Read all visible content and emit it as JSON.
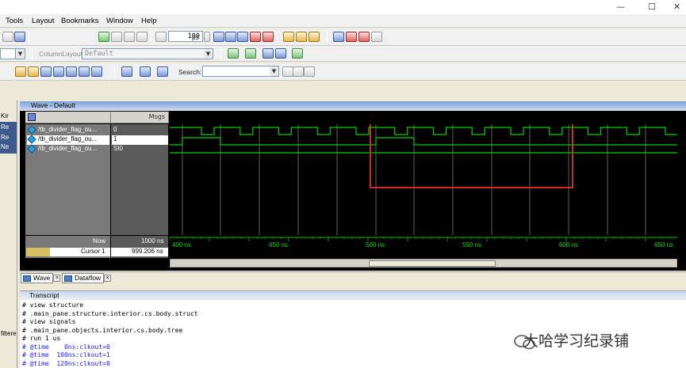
{
  "menu": [
    "Tools",
    "Layout",
    "Bookmarks",
    "Window",
    "Help"
  ],
  "toolbar": {
    "run_length_value": "100",
    "run_length_unit": "ps",
    "column_layout_label": "ColumnLayout",
    "column_layout_value": "Default",
    "search_label": "Search:"
  },
  "left_strip": [
    "Kir",
    "Re",
    "Re",
    "Ne",
    "filtere"
  ],
  "wave": {
    "title": "Wave - Default",
    "msgs_header": "Msgs",
    "signals": [
      {
        "name": "/tb_divider_flag_ou...",
        "value": "0"
      },
      {
        "name": "/tb_divider_flag_ou...",
        "value": "1"
      },
      {
        "name": "/tb_divider_flag_ou...",
        "value": "St0"
      }
    ],
    "now_label": "Now",
    "now_value": "1000 ns",
    "cursor_label": "Cursor 1",
    "cursor_value": "999.206 ns",
    "timescale": [
      "400 ns",
      "450 ns",
      "500 ns",
      "550 ns",
      "600 ns",
      "650 ns"
    ],
    "waveform_color": "#00d000",
    "highlight_color": "#e03030"
  },
  "tabs": [
    {
      "label": "Wave"
    },
    {
      "label": "Dataflow"
    }
  ],
  "transcript": {
    "title": "Transcript",
    "lines": [
      {
        "text": "# view structure",
        "color": "black"
      },
      {
        "text": "# .main_pane.structure.interior.cs.body.struct",
        "color": "black"
      },
      {
        "text": "# view signals",
        "color": "black"
      },
      {
        "text": "# .main_pane.objects.interior.cs.body.tree",
        "color": "black"
      },
      {
        "text": "# run 1 us",
        "color": "black"
      },
      {
        "text": "# @time    0ns:clkout=0",
        "color": "blue"
      },
      {
        "text": "# @time  100ns:clkout=1",
        "color": "blue"
      },
      {
        "text": "# @time  120ns:clkout=0",
        "color": "blue"
      }
    ]
  },
  "watermark": "大哈学习纪录铺"
}
